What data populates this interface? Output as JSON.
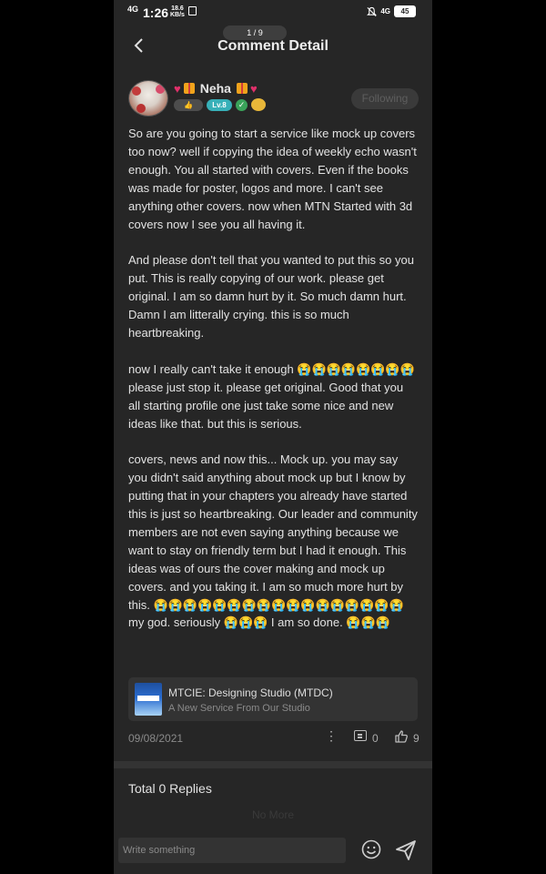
{
  "status_bar": {
    "network": "4G",
    "time": "1:26",
    "speed_value": "18.6",
    "speed_unit": "KB/s",
    "network_right": "4G",
    "battery": "45"
  },
  "header": {
    "page_indicator": "1 / 9",
    "title": "Comment Detail"
  },
  "user": {
    "name": "Neha",
    "level": "Lv.8",
    "follow_label": "Following",
    "accent_colors": {
      "level_badge": "#37b0b8",
      "heart": "#e0306a"
    }
  },
  "post": {
    "body": "So are you going to start a service like mock up covers too now? well if copying the idea of weekly echo wasn't enough. You all started with covers. Even if the books was made for poster, logos and more. I can't see anything other covers. now when MTN Started with 3d covers now I see you all having it.\n\nAnd please don't tell that you wanted to put this so you put. This is really copying of our work. please get original. I am so damn hurt by it. So much damn hurt. Damn I am litterally crying. this is so much heartbreaking.\n\nnow I really can't take it enough 😭😭😭😭😭😭😭😭 please just stop it. please get original. Good that you all starting profile one just take some nice and new ideas like that. but this is serious.\n\ncovers, news and now this... Mock up. you may say you didn't said anything about mock up but I know by putting that in your chapters you already have started this is just so heartbreaking. Our leader and community members are not even saying anything because we want to stay on friendly term but I had it enough. This ideas was of ours the cover making and mock up covers. and you taking it. I am so much more hurt by this. 😭😭😭😭😭😭😭😭😭😭😭😭😭😭😭😭😭 my god. seriously 😭😭😭 I am so done. 😭😭😭",
    "link_card": {
      "title": "MTCIE: Designing Studio (MTDC)",
      "subtitle": "A New Service From Our Studio"
    },
    "date": "09/08/2021",
    "more": "⋮",
    "comment_count": "0",
    "like_count": "9"
  },
  "replies": {
    "total_label": "Total 0 Replies",
    "no_more": "No More"
  },
  "input": {
    "placeholder": "Write something"
  }
}
